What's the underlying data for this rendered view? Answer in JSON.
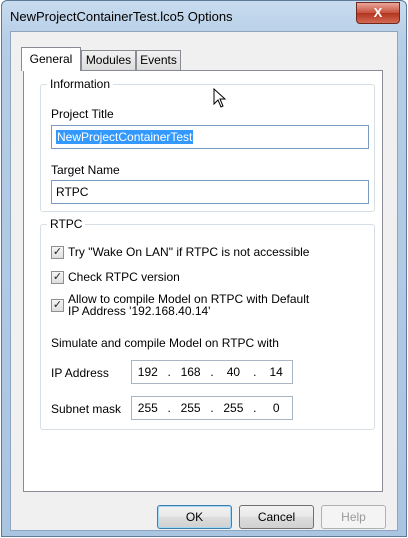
{
  "window": {
    "title": "NewProjectContainerTest.lco5 Options",
    "close_glyph": "X"
  },
  "tabs": [
    {
      "label": "General",
      "active": true
    },
    {
      "label": "Modules",
      "active": false
    },
    {
      "label": "Events",
      "active": false
    }
  ],
  "information": {
    "group_label": "Information",
    "project_title_label": "Project Title",
    "project_title_value": "NewProjectContainerTest",
    "target_name_label": "Target Name",
    "target_name_value": "RTPC"
  },
  "rtpc": {
    "group_label": "RTPC",
    "checkboxes": [
      {
        "label": "Try \"Wake On LAN\" if RTPC is not accessible",
        "checked": true
      },
      {
        "label": "Check RTPC version",
        "checked": true
      },
      {
        "label_line1": "Allow to compile Model on RTPC with Default",
        "label_line2": "IP Address '192.168.40.14'",
        "checked": true
      }
    ],
    "simulate_label": "Simulate and compile Model on RTPC with",
    "ip_label": "IP Address",
    "ip_octets": [
      "192",
      "168",
      "40",
      "14"
    ],
    "subnet_label": "Subnet mask",
    "subnet_octets": [
      "255",
      "255",
      "255",
      "0"
    ],
    "octet_separator": "."
  },
  "buttons": {
    "ok": "OK",
    "cancel": "Cancel",
    "help": "Help"
  },
  "check_glyph": "✓"
}
